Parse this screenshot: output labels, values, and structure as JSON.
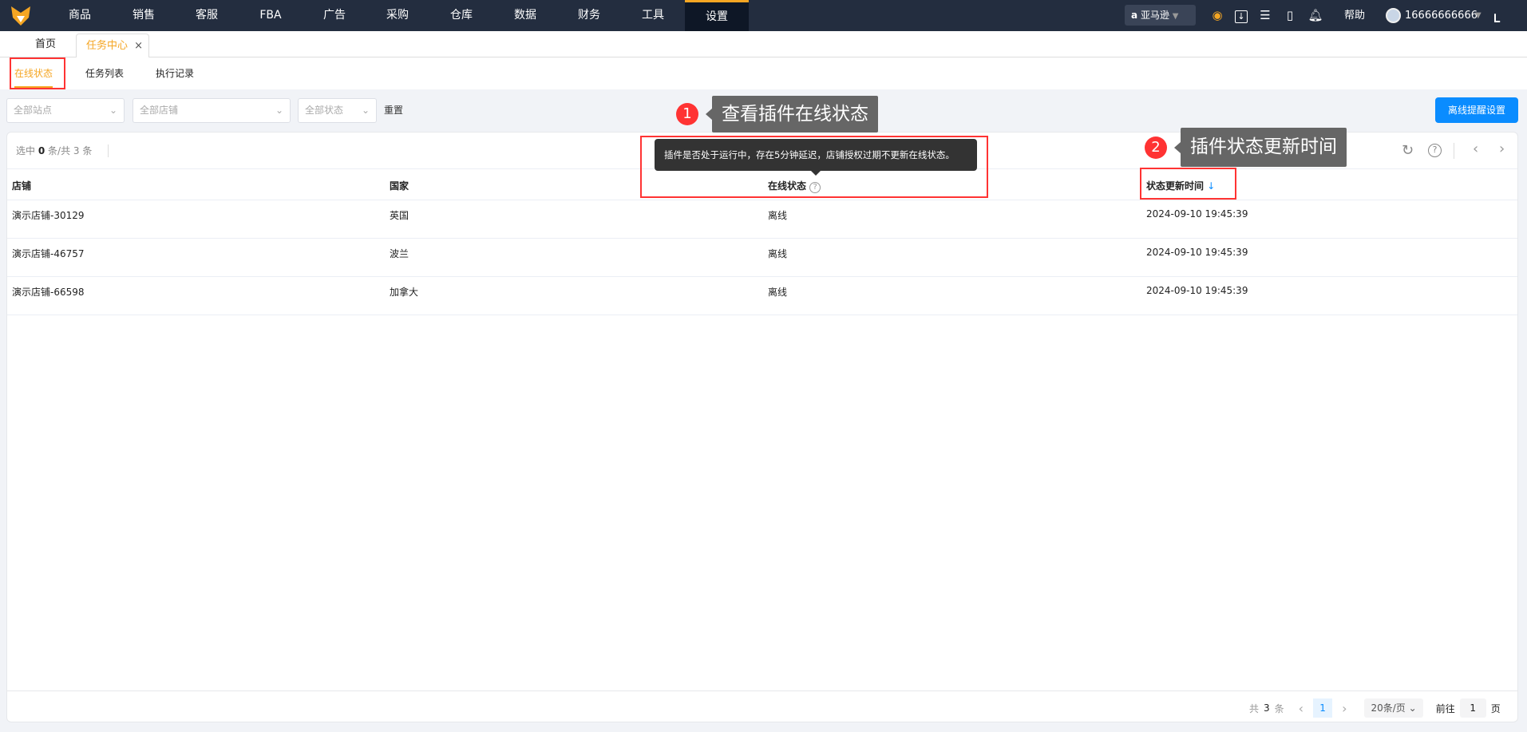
{
  "nav": {
    "items": [
      "商品",
      "销售",
      "客服",
      "FBA",
      "广告",
      "采购",
      "仓库",
      "数据",
      "财务",
      "工具",
      "设置"
    ],
    "active": "设置",
    "platform": "亚马逊",
    "help": "帮助",
    "user": "16666666666"
  },
  "tabs": {
    "home": "首页",
    "current": "任务中心",
    "close": "×"
  },
  "subtabs": [
    "在线状态",
    "任务列表",
    "执行记录"
  ],
  "filters": {
    "site": "全部站点",
    "shop": "全部店铺",
    "status": "全部状态",
    "reset": "重置",
    "settings_button": "离线提醒设置"
  },
  "toolbar": {
    "sel_prefix": "选中",
    "selected": "0",
    "sel_mid": "条/共",
    "total": "3",
    "sel_suffix": "条"
  },
  "table": {
    "headers": [
      "店铺",
      "国家",
      "在线状态",
      "状态更新时间"
    ],
    "sort_icon": "↓",
    "rows": [
      [
        "演示店铺-30129",
        "英国",
        "离线",
        "2024-09-10 19:45:39"
      ],
      [
        "演示店铺-46757",
        "波兰",
        "离线",
        "2024-09-10 19:45:39"
      ],
      [
        "演示店铺-66598",
        "加拿大",
        "离线",
        "2024-09-10 19:45:39"
      ]
    ]
  },
  "tooltip": "插件是否处于运行中，存在5分钟延迟，店铺授权过期不更新在线状态。",
  "annotations": [
    {
      "num": "1",
      "text": "查看插件在线状态"
    },
    {
      "num": "2",
      "text": "插件状态更新时间"
    }
  ],
  "pagination": {
    "total_prefix": "共",
    "total": "3",
    "total_suffix": "条",
    "page": "1",
    "page_size": "20条/页",
    "goto": "前往",
    "goto_value": "1",
    "page_suffix": "页"
  },
  "colors": {
    "accent": "#f5a623",
    "primary": "#0a8cff",
    "nav": "#232d3f",
    "annotation": "#ff3333"
  }
}
